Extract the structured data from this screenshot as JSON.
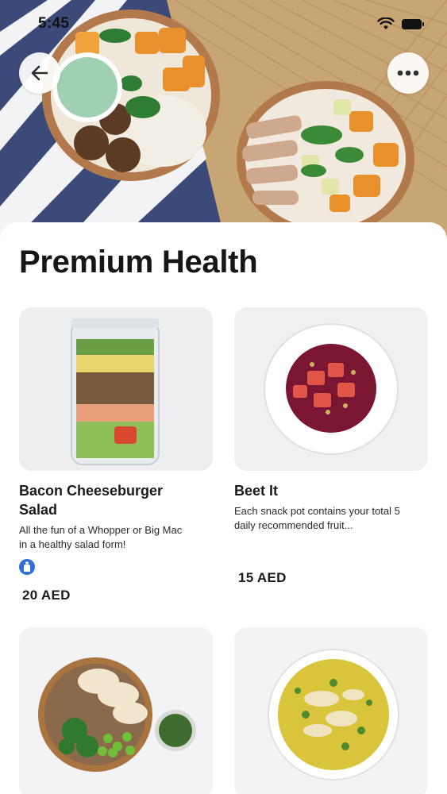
{
  "status_bar": {
    "time": "5:45",
    "icons": [
      "wifi-icon",
      "battery-icon"
    ]
  },
  "header": {
    "back_icon": "arrow-left-icon",
    "more_icon": "ellipsis-icon"
  },
  "page": {
    "title": "Premium Health"
  },
  "products": [
    {
      "name": "Bacon Cheeseburger Salad",
      "name_line1": "Bacon Cheeseburger",
      "name_line2": "Salad",
      "description_line1": "All the fun of a Whopper or Big Mac",
      "description_line2": "in a healthy salad form!",
      "badge_icon": "bottle-icon",
      "price": "20 AED"
    },
    {
      "name": "Beet It",
      "description_line1": "Each snack pot contains your total 5",
      "description_line2": "daily recommended fruit...",
      "price": "15 AED"
    },
    {
      "image": "chicken-quinoa-bowl"
    },
    {
      "image": "chicken-soup-bowl"
    }
  ],
  "colors": {
    "accent": "#2f6fd6",
    "card_background": "#f1f1f3",
    "text": "#1b1b1b"
  }
}
